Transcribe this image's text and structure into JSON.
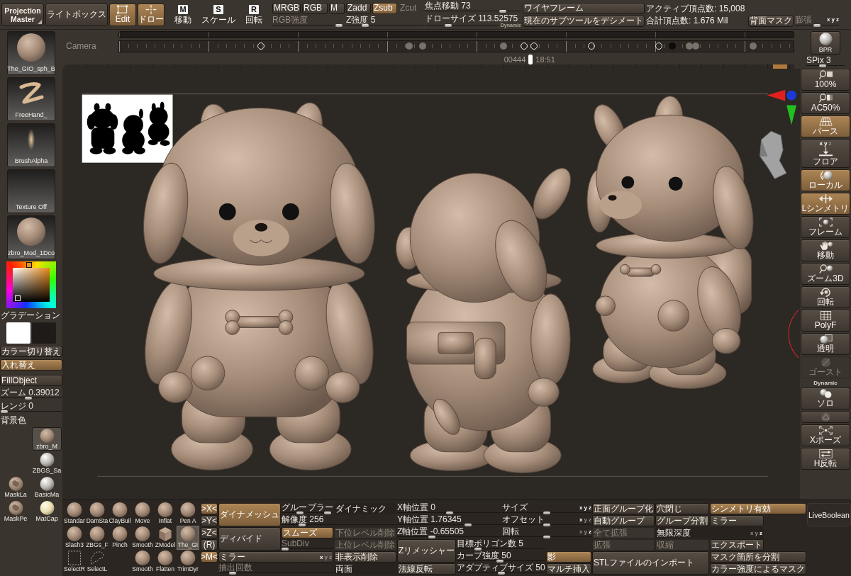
{
  "top_bar": {
    "projection_master": "Projection Master",
    "lightbox": "ライトボックス",
    "modes": [
      {
        "kind": "edit",
        "label": "Edit",
        "selected": true
      },
      {
        "kind": "draw",
        "label": "ドロー",
        "selected": true
      }
    ],
    "transforms": [
      {
        "key": "M",
        "label": "移動",
        "selected": false
      },
      {
        "key": "S",
        "label": "スケール",
        "selected": false
      },
      {
        "key": "R",
        "label": "回転",
        "selected": false
      }
    ],
    "color_modes": [
      {
        "label": "MRGB",
        "selected": false
      },
      {
        "label": "RGB",
        "selected": false
      },
      {
        "label": "M",
        "selected": false
      }
    ],
    "rgb_intensity": {
      "label": "RGB強度",
      "level": 0.97,
      "disabled": true
    },
    "z_modes": [
      {
        "label": "Zadd",
        "selected": false,
        "disabled": false
      },
      {
        "label": "Zsub",
        "selected": true,
        "disabled": false
      },
      {
        "label": "Zcut",
        "selected": false,
        "disabled": true
      }
    ],
    "z_intensity": {
      "label": "Z強度",
      "value": "5",
      "level": 0.22,
      "disabled": false
    },
    "focal_shift": {
      "label": "焦点移動",
      "value": "73",
      "level": 0.83,
      "disabled": false
    },
    "draw_size": {
      "label": "ドローサイズ",
      "value": "113.52575",
      "level": 0.3,
      "disabled": false,
      "badge": "Dynamic"
    },
    "wireframe": "ワイヤフレーム",
    "decimate": "現在のサブツールをデシメート",
    "active_points": "アクティブ頂点数: 15,008",
    "total_points": "合計頂点数: 1.676 Mil",
    "backface_mask": "背面マスク",
    "inflate": {
      "label": "膨張",
      "level": 0.5,
      "disabled": true,
      "axes": [
        {
          "label": "x",
          "on": true
        },
        {
          "label": "y",
          "on": true
        },
        {
          "label": "z",
          "on": true
        }
      ]
    }
  },
  "timeline": {
    "label": "Camera",
    "frame": "00444",
    "time": "18:51",
    "level": 0.61
  },
  "left_panel": {
    "thumbnails": [
      {
        "kind": "tool",
        "label": "The_GIO_sph_B"
      },
      {
        "kind": "stroke",
        "label": "FreeHand_"
      },
      {
        "kind": "alpha",
        "label": "BrushAlpha"
      },
      {
        "kind": "texture",
        "label": "Texture Off"
      },
      {
        "kind": "material",
        "label": "zbro_Mod_1Dco"
      }
    ],
    "gradient_label": "グラデーション",
    "swatches": [
      {
        "color": "#ffffff"
      },
      {
        "color": "#1f1b18"
      }
    ],
    "buttons": [
      {
        "label": "カラー切り替え",
        "selected": false
      },
      {
        "label": "入れ替え",
        "selected": true
      },
      {
        "label": "FillObject",
        "selected": false
      }
    ],
    "zoom": {
      "label": "ズーム",
      "value": "0.39012",
      "level": 0.45
    },
    "range": {
      "label": "レンジ",
      "value": "0",
      "level": 0
    },
    "background_label": "背景色",
    "materials": [
      {
        "kind": "clay",
        "label": "zbro_M",
        "selected": true
      },
      {
        "kind": "white",
        "label": "ZBGS_Sa",
        "selected": false
      },
      {
        "kind": "mask",
        "label": "MaskLa",
        "selected": false
      },
      {
        "kind": "white",
        "label": "BasicMa",
        "selected": false
      },
      {
        "kind": "mask",
        "label": "MaskPe",
        "selected": false
      },
      {
        "kind": "cream",
        "label": "MatCap",
        "selected": false
      }
    ]
  },
  "right_shelf": {
    "bpr": "BPR",
    "spix": {
      "label": "SPix",
      "value": "3",
      "level": 0.4
    },
    "buttons": [
      {
        "kind": "zoom100",
        "label": "100%",
        "selected": false,
        "disabled": false
      },
      {
        "kind": "ac50",
        "label": "AC50%",
        "selected": false,
        "disabled": false
      },
      {
        "kind": "perspective",
        "label": "パース",
        "selected": true,
        "disabled": false
      },
      {
        "kind": "floor",
        "label": "フロア",
        "selected": false,
        "disabled": false,
        "axes": [
          {
            "label": "x",
            "on": true
          },
          {
            "label": "y",
            "on": true
          },
          {
            "label": "z",
            "on": false
          }
        ]
      },
      {
        "kind": "local",
        "label": "ローカル",
        "selected": true,
        "disabled": false
      },
      {
        "kind": "lsym",
        "label": "Lシンメトリ",
        "selected": true,
        "disabled": false
      },
      {
        "kind": "frame",
        "label": "フレーム",
        "selected": false,
        "disabled": false
      },
      {
        "kind": "move",
        "label": "移動",
        "selected": false,
        "disabled": false
      },
      {
        "kind": "zoom3d",
        "label": "ズーム3D",
        "selected": false,
        "disabled": false
      },
      {
        "kind": "rotate",
        "label": "回転",
        "selected": false,
        "disabled": false
      },
      {
        "kind": "polyf",
        "label": "PolyF",
        "selected": false,
        "disabled": false
      },
      {
        "kind": "transparent",
        "label": "透明",
        "selected": false,
        "disabled": false
      },
      {
        "kind": "ghost",
        "label": "ゴースト",
        "selected": false,
        "disabled": true
      },
      {
        "kind": "solo",
        "label": "ソロ",
        "note": "Dynamic",
        "selected": false,
        "disabled": false
      },
      {
        "kind": "sphere",
        "selected": false,
        "disabled": false
      },
      {
        "kind": "xpose",
        "label": "Xポーズ",
        "selected": false,
        "disabled": false
      },
      {
        "kind": "flip",
        "label": "H反転",
        "selected": false,
        "disabled": false
      }
    ]
  },
  "bottom_panel": {
    "brush_rows": [
      [
        {
          "kind": "sphere",
          "label": "Standar",
          "selected": false
        },
        {
          "kind": "sphere",
          "label": "DamSta",
          "selected": false
        },
        {
          "kind": "sphere",
          "label": "ClayBuil",
          "selected": false
        },
        {
          "kind": "sphere",
          "label": "Move",
          "selected": false
        },
        {
          "kind": "sphere",
          "label": "Inflat",
          "selected": false
        },
        {
          "kind": "sphere",
          "label": "Pen A",
          "selected": false
        }
      ],
      [
        {
          "kind": "sphere",
          "label": "Slash3",
          "selected": false
        },
        {
          "kind": "sphere",
          "label": "ZBGs_F",
          "selected": false
        },
        {
          "kind": "sphere",
          "label": "Pinch",
          "selected": false
        },
        {
          "kind": "sphere",
          "label": "Smooth",
          "selected": false
        },
        {
          "kind": "cube",
          "label": "ZModel",
          "selected": false
        },
        {
          "kind": "sphere",
          "label": "The_GI",
          "selected": true
        }
      ],
      [
        {
          "kind": "rect_select",
          "label": "SelectR",
          "selected": false
        },
        {
          "kind": "lasso_select",
          "label": "SelectL",
          "selected": false
        },
        {
          "kind": "sphere",
          "label": "Smooth",
          "selected": false
        },
        {
          "kind": "sphere",
          "label": "Flatten",
          "selected": false
        },
        {
          "kind": "sphere",
          "label": "TrimDyr",
          "selected": false
        }
      ]
    ],
    "symmetry": [
      {
        "label": ">X<",
        "selected": true
      },
      {
        "label": ">Y<",
        "selected": false
      },
      {
        "label": ">Z<",
        "selected": false
      },
      {
        "label": "(R)",
        "selected": false
      },
      {
        "label": ">M<",
        "selected": true
      }
    ],
    "controls": [
      {
        "kind": "button",
        "label": "ダイナメッシュ",
        "selected": true,
        "disabled": false
      },
      {
        "kind": "slider",
        "label": "グルー",
        "level": 0.8,
        "disabled": false
      },
      {
        "kind": "slider",
        "label": "ブラー",
        "level": 0.9,
        "disabled": false
      },
      {
        "kind": "toggle",
        "label": "ダイナミック",
        "selected": false,
        "disabled": false
      },
      {
        "kind": "slider",
        "label": "解像度",
        "value": "256",
        "level": 0.16,
        "disabled": false
      },
      {
        "kind": "button",
        "label": "ディバイド",
        "selected": false,
        "disabled": false
      },
      {
        "kind": "button",
        "label": "スムーズ",
        "selected": true,
        "disabled": false
      },
      {
        "kind": "button",
        "label": "下位レベル削除",
        "selected": false,
        "disabled": true
      },
      {
        "kind": "slider",
        "label": "SubDiv",
        "level": 0,
        "disabled": true
      },
      {
        "kind": "button",
        "label": "上位レベル削除",
        "selected": false,
        "disabled": true
      },
      {
        "kind": "button",
        "label": "ミラー",
        "selected": false,
        "disabled": false,
        "axes": [
          {
            "label": "x",
            "on": true
          },
          {
            "label": "y",
            "on": false
          },
          {
            "label": "z",
            "on": false
          }
        ]
      },
      {
        "kind": "button",
        "label": "非表示削除",
        "selected": false,
        "disabled": false
      },
      {
        "kind": "slider",
        "label": "抽出回数",
        "level": 0.1,
        "disabled": true
      },
      {
        "kind": "toggle",
        "label": "両面",
        "selected": false,
        "disabled": false
      },
      {
        "kind": "slider",
        "label": "X軸位置",
        "value": "0",
        "level": 0.5,
        "disabled": false
      },
      {
        "kind": "slider",
        "label": "サイズ",
        "level": 0.5,
        "disabled": false,
        "axes": [
          {
            "label": "x",
            "on": true
          },
          {
            "label": "y",
            "on": true
          },
          {
            "label": "z",
            "on": true
          }
        ]
      },
      {
        "kind": "slider",
        "label": "Y軸位置",
        "value": "1.76345",
        "level": 0.69,
        "disabled": false
      },
      {
        "kind": "slider",
        "label": "オフセット",
        "level": 0.5,
        "disabled": false,
        "axes": [
          {
            "label": "x",
            "on": true
          },
          {
            "label": "y",
            "on": false
          },
          {
            "label": "z",
            "on": false
          }
        ]
      },
      {
        "kind": "slider",
        "label": "Z軸位置",
        "value": "-0.65505",
        "level": 0.32,
        "disabled": false
      },
      {
        "kind": "slider",
        "label": "回転",
        "level": 0.5,
        "disabled": false,
        "axes": [
          {
            "label": "x",
            "on": false
          },
          {
            "label": "y",
            "on": false
          },
          {
            "label": "z",
            "on": true
          }
        ]
      },
      {
        "kind": "button",
        "label": "Zリメッシャー",
        "selected": false,
        "disabled": false
      },
      {
        "kind": "slider",
        "label": "目標ポリゴン数",
        "value": "5",
        "level": 0.22,
        "disabled": false
      },
      {
        "kind": "slider",
        "label": "カーブ強度",
        "value": "50",
        "level": 0.49,
        "disabled": false
      },
      {
        "kind": "button",
        "label": "影",
        "selected": true,
        "disabled": false
      },
      {
        "kind": "button",
        "label": "法線反転",
        "selected": false,
        "disabled": false
      },
      {
        "kind": "slider",
        "label": "アダプティブサイズ",
        "value": "50",
        "level": 0.5,
        "disabled": false
      },
      {
        "kind": "button",
        "label": "マルチ挿入",
        "selected": false,
        "disabled": false
      },
      {
        "kind": "button",
        "label": "正面グループ化",
        "selected": false,
        "disabled": false
      },
      {
        "kind": "button",
        "label": "穴閉じ",
        "selected": false,
        "disabled": false
      },
      {
        "kind": "button",
        "label": "シンメトリ有効",
        "selected": true,
        "disabled": false
      },
      {
        "kind": "button",
        "label": "自動グループ",
        "selected": false,
        "disabled": false
      },
      {
        "kind": "button",
        "label": "グループ分割",
        "selected": false,
        "disabled": false
      },
      {
        "kind": "button",
        "label": "ミラー",
        "selected": false,
        "disabled": false
      },
      {
        "kind": "button",
        "label": "全て拡張",
        "selected": false,
        "disabled": true
      },
      {
        "kind": "toggle",
        "label": "無限深度",
        "selected": false,
        "disabled": false,
        "axes": [
          {
            "label": "x",
            "on": false
          },
          {
            "label": "y",
            "on": false
          },
          {
            "label": "z",
            "on": true
          }
        ]
      },
      {
        "kind": "button",
        "label": "拡張",
        "selected": false,
        "disabled": true
      },
      {
        "kind": "button",
        "label": "収縮",
        "selected": false,
        "disabled": true
      },
      {
        "kind": "button",
        "label": "エクスポート",
        "selected": false,
        "disabled": false
      },
      {
        "kind": "button",
        "label": "STLファイルのインポート",
        "selected": false,
        "disabled": false
      },
      {
        "kind": "button",
        "label": "マスク箇所を分割",
        "selected": false,
        "disabled": false
      },
      {
        "kind": "button",
        "label": "カラー強度によるマスク",
        "selected": false,
        "disabled": false
      },
      {
        "kind": "panel",
        "label": "LiveBoolean"
      }
    ]
  }
}
